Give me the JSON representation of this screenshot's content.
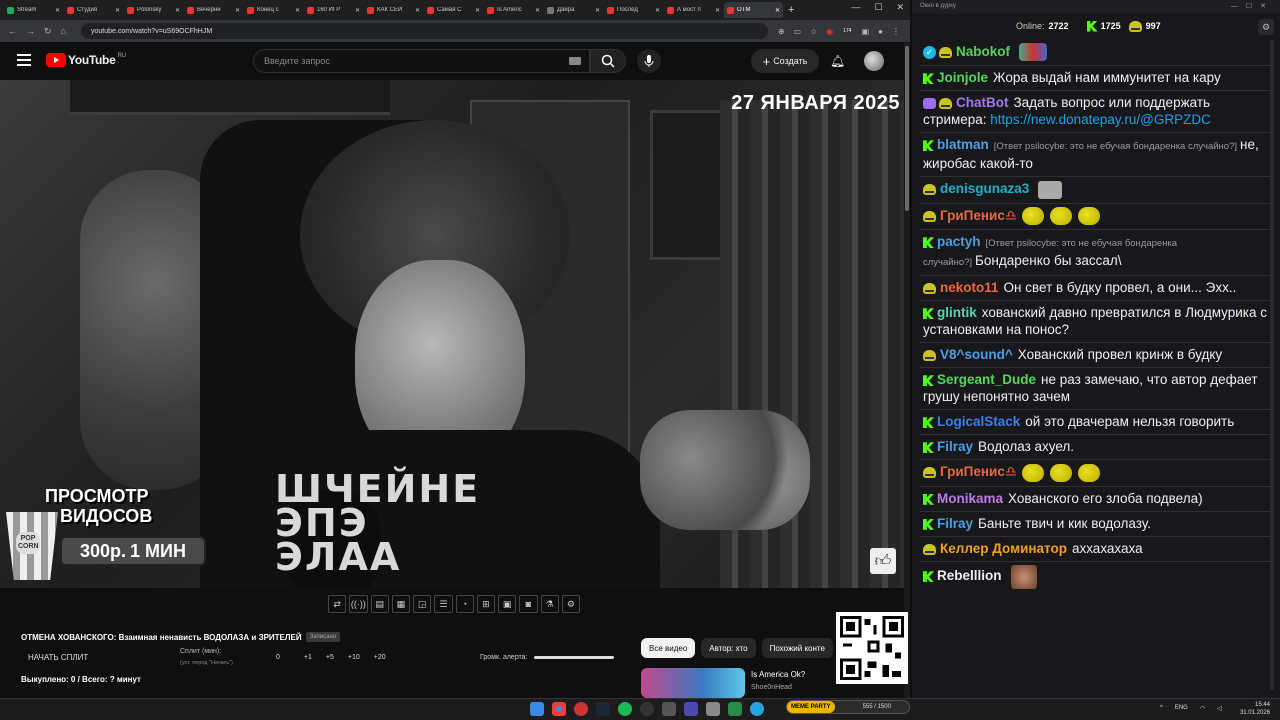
{
  "browser": {
    "tabs": [
      {
        "label": "Stream",
        "fav": "kick"
      },
      {
        "label": "Студия",
        "fav": "yt"
      },
      {
        "label": "Polonsky",
        "fav": "yt"
      },
      {
        "label": "Вечерни",
        "fav": "yt"
      },
      {
        "label": "Конец с",
        "fav": "yt"
      },
      {
        "label": "160 ИГР",
        "fav": "yt"
      },
      {
        "label": "КАК СЕЙ",
        "fav": "yt"
      },
      {
        "label": "Самая С",
        "fav": "yt"
      },
      {
        "label": "Is Americ",
        "fav": "yt"
      },
      {
        "label": "Дäйра",
        "fav": "other"
      },
      {
        "label": "Послед",
        "fav": "yt"
      },
      {
        "label": "А мост п",
        "fav": "yt"
      },
      {
        "label": "ОТМ",
        "fav": "yt"
      }
    ],
    "url": "youtube.com/watch?v=uS69OCFhHJM",
    "badge_count": "174"
  },
  "youtube": {
    "logo_text": "YouTube",
    "region": "RU",
    "search_placeholder": "Введите запрос",
    "create_label": "Создать",
    "video": {
      "date_caption": "27 ЯНВАРЯ 2025",
      "shirt_text": "ШЧЕЙНЕ\nЭПЭ\nЭЛАА",
      "promo_line1": "ПРОСМОТР",
      "promo_line2": "ВИДОСОВ",
      "promo_price": "300р.",
      "promo_duration": "1 МИН",
      "popcorn_label": "POP CORN"
    },
    "title": "ОТМЕНА ХОВАНСКОГО: Взаимная ненависть ВОДОЛАЗА и ЗРИТЕЛЕЙ",
    "title_tag": "Записано",
    "split_button": "НАЧАТЬ СПЛИТ",
    "split_label": "Сплит (мин):",
    "split_hint": "(уст. перед \"Начать\")",
    "split_values": [
      "0",
      "+1",
      "+5",
      "+10",
      "+20"
    ],
    "bought": "Выкуплено: 0 / Всего: ? минут",
    "volume_label": "Громк. алерта:",
    "chips": [
      "Все видео",
      "Автор: хто",
      "Похожий конте"
    ],
    "rec_title": "Is America Ok?",
    "rec_channel": "Shoe0nHead"
  },
  "chat": {
    "window_title": "Окно в дурку",
    "online_label": "Online:",
    "online_count": "2722",
    "kick_count": "1725",
    "other_count": "997",
    "messages": [
      {
        "name": "Nabokof",
        "color": "#53d65a",
        "text": "",
        "badge": "verified-pepe",
        "emote": "flag"
      },
      {
        "name": "Joinjole",
        "color": "#53d65a",
        "text": "Жора выдай нам иммунитет на кару",
        "badge": "kick"
      },
      {
        "name": "ChatBot",
        "color": "#a078f0",
        "text": "Задать вопрос или поддержать стримера: ",
        "link": "https://new.donatepay.ru/@GRPZDC",
        "badge": "bot"
      },
      {
        "name": "blatman",
        "color": "#49a0e8",
        "reply": "[Ответ psilocybe: это не ебучая бондаренка случайно?]",
        "text": "не, жиробас какой-то",
        "badge": "kick"
      },
      {
        "name": "denisgunaza3",
        "color": "#1fb0c8",
        "text": "",
        "badge": "pepe",
        "emote": "gray"
      },
      {
        "name": "ГриПенис♎",
        "color": "#e86a3a",
        "text": "",
        "badge": "pepe",
        "emote": "pepes"
      },
      {
        "name": "pactyh",
        "color": "#49a0e8",
        "reply": "[Ответ psilocybe: это не ебучая бондаренка случайно?]",
        "text": "Бондаренко бы зассал\\",
        "badge": "kick"
      },
      {
        "name": "nekoto11",
        "color": "#e86a3a",
        "text": "Он свет в будку провел, а они... Эхх..",
        "badge": "pepe"
      },
      {
        "name": "glintik",
        "color": "#53d6b0",
        "text": "хованский давно превратился в Людмурика с установками на понос?",
        "badge": "kick"
      },
      {
        "name": "V8^sound^",
        "color": "#49a0e8",
        "text": "Хованский провел кринж в будку",
        "badge": "pepe"
      },
      {
        "name": "Sergeant_Dude",
        "color": "#53d65a",
        "text": "не раз замечаю, что автор дефает грушу непонятно зачем",
        "badge": "kick"
      },
      {
        "name": "LogicalStack",
        "color": "#3a80e8",
        "text": "ой это двачерам нельзя говорить",
        "badge": "kick"
      },
      {
        "name": "Filray",
        "color": "#49a0e8",
        "text": "Водолаз ахуел.",
        "badge": "kick"
      },
      {
        "name": "ГриПенис♎",
        "color": "#e86a3a",
        "text": "",
        "badge": "pepe",
        "emote": "pepes"
      },
      {
        "name": "Monikama",
        "color": "#c07ae8",
        "text": "Хованского его злоба подвела)",
        "badge": "kick"
      },
      {
        "name": "Filray",
        "color": "#49a0e8",
        "text": "Баньте твич и кик водолазу.",
        "badge": "kick"
      },
      {
        "name": "Келлер Доминатор",
        "color": "#f0a020",
        "text": "аххахахаха",
        "badge": "pepe"
      },
      {
        "name": "Rebelllion",
        "color": "#efeff1",
        "text": "",
        "badge": "kick",
        "emote": "face"
      }
    ]
  },
  "taskbar": {
    "lang": "ENG",
    "time": "15:44",
    "date": "31.01.2026",
    "meme_party": "MEME PARTY",
    "meme_counter": "555 / 1500"
  },
  "colors": {
    "yt_red": "#ff0000",
    "kick_green": "#53fc18",
    "link": "#1fa0e8"
  }
}
